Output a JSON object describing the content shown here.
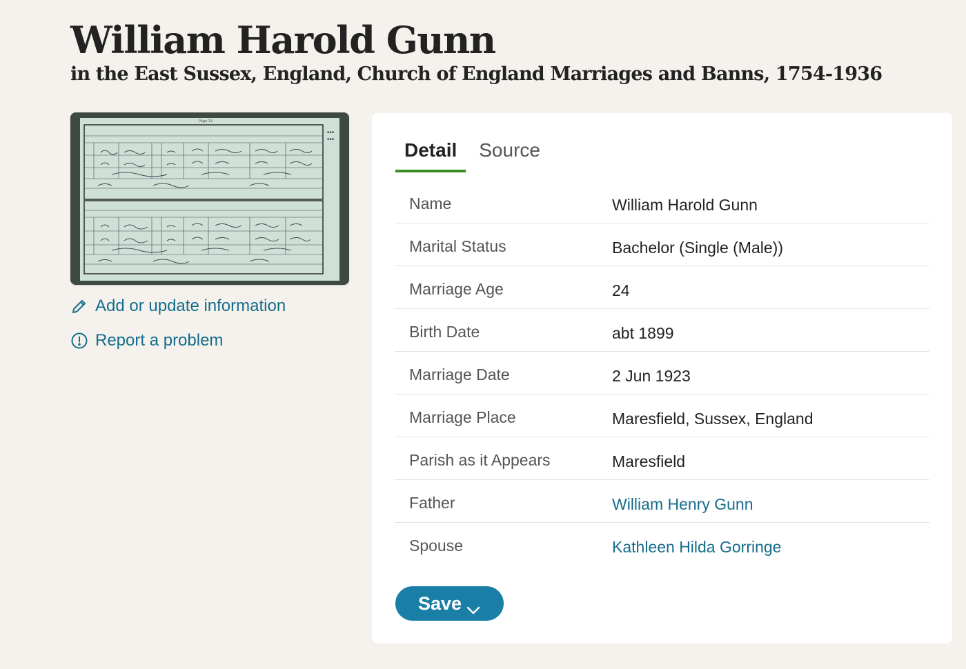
{
  "record": {
    "title": "William Harold Gunn",
    "subtitle": "in the East Sussex, England, Church of England Marriages and Banns, 1754-1936"
  },
  "sidebar": {
    "add_update": "Add or update information",
    "report": "Report a problem"
  },
  "tabs": [
    {
      "label": "Detail",
      "active": true
    },
    {
      "label": "Source",
      "active": false
    }
  ],
  "details": [
    {
      "label": "Name",
      "value": "William Harold Gunn"
    },
    {
      "label": "Marital Status",
      "value": "Bachelor (Single (Male))"
    },
    {
      "label": "Marriage Age",
      "value": "24"
    },
    {
      "label": "Birth Date",
      "value": "abt 1899"
    },
    {
      "label": "Marriage Date",
      "value": "2 Jun 1923"
    },
    {
      "label": "Marriage Place",
      "value": "Maresfield, Sussex, England"
    },
    {
      "label": "Parish as it Appears",
      "value": "Maresfield"
    },
    {
      "label": "Father",
      "value": "William Henry Gunn"
    },
    {
      "label": "Spouse",
      "value": "Kathleen Hilda Gorringe"
    }
  ],
  "actions": {
    "save_label": "Save"
  },
  "colors": {
    "link": "#156d8c",
    "tab_accent": "#3a8c1c",
    "save_bg": "#1a7fa6"
  }
}
